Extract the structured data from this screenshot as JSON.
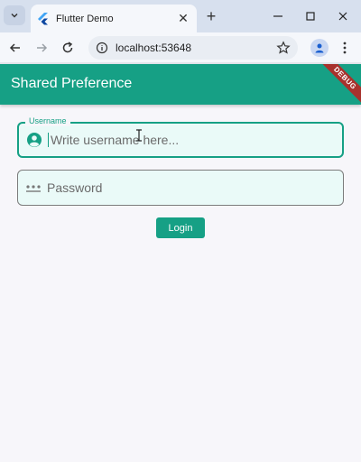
{
  "browser": {
    "tab_title": "Flutter Demo",
    "url": "localhost:53648"
  },
  "app": {
    "title": "Shared Preference",
    "debug_banner": "DEBUG",
    "username": {
      "label": "Username",
      "placeholder": "Write username here..."
    },
    "password": {
      "placeholder": "Password"
    },
    "login_label": "Login"
  },
  "colors": {
    "primary": "#16a085",
    "field_fill": "#eafaf8",
    "debug": "#a8322d"
  }
}
